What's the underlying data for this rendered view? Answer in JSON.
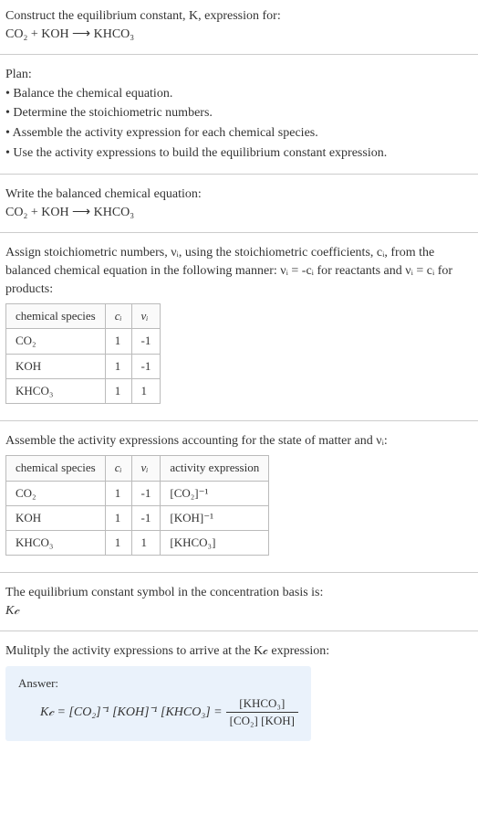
{
  "intro": {
    "line1": "Construct the equilibrium constant, K, expression for:",
    "equation": "CO₂ + KOH ⟶ KHCO₃"
  },
  "plan": {
    "heading": "Plan:",
    "items": [
      "• Balance the chemical equation.",
      "• Determine the stoichiometric numbers.",
      "• Assemble the activity expression for each chemical species.",
      "• Use the activity expressions to build the equilibrium constant expression."
    ]
  },
  "balanced": {
    "heading": "Write the balanced chemical equation:",
    "equation": "CO₂ + KOH ⟶ KHCO₃"
  },
  "assign": {
    "text": "Assign stoichiometric numbers, νᵢ, using the stoichiometric coefficients, cᵢ, from the balanced chemical equation in the following manner: νᵢ = -cᵢ for reactants and νᵢ = cᵢ for products:",
    "headers": {
      "h1": "chemical species",
      "h2": "cᵢ",
      "h3": "νᵢ"
    },
    "rows": [
      {
        "species": "CO₂",
        "c": "1",
        "v": "-1"
      },
      {
        "species": "KOH",
        "c": "1",
        "v": "-1"
      },
      {
        "species": "KHCO₃",
        "c": "1",
        "v": "1"
      }
    ]
  },
  "activity": {
    "text": "Assemble the activity expressions accounting for the state of matter and νᵢ:",
    "headers": {
      "h1": "chemical species",
      "h2": "cᵢ",
      "h3": "νᵢ",
      "h4": "activity expression"
    },
    "rows": [
      {
        "species": "CO₂",
        "c": "1",
        "v": "-1",
        "expr": "[CO₂]⁻¹"
      },
      {
        "species": "KOH",
        "c": "1",
        "v": "-1",
        "expr": "[KOH]⁻¹"
      },
      {
        "species": "KHCO₃",
        "c": "1",
        "v": "1",
        "expr": "[KHCO₃]"
      }
    ]
  },
  "symbol": {
    "line1": "The equilibrium constant symbol in the concentration basis is:",
    "line2": "K𝒸"
  },
  "multiply": {
    "text": "Mulitply the activity expressions to arrive at the K𝒸 expression:"
  },
  "answer": {
    "label": "Answer:",
    "lhs": "K𝒸 = [CO₂]⁻¹ [KOH]⁻¹ [KHCO₃] =",
    "frac_num": "[KHCO₃]",
    "frac_den": "[CO₂] [KOH]"
  }
}
